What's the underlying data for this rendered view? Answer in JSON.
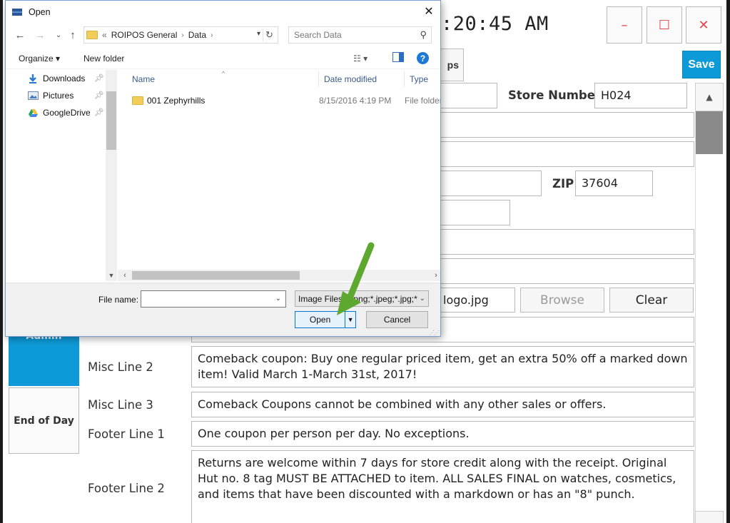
{
  "app": {
    "clock": ":20:45 AM",
    "window_buttons": {
      "minimize": "–",
      "maximize": "☐",
      "close": "✕"
    },
    "tab_partial": "ps",
    "save_label": "Save",
    "store_number_label": "Store Number",
    "store_number_value": "H024",
    "zip_label": "ZIP",
    "zip_value": "37604",
    "logo_value": "logo.jpg",
    "browse_label": "Browse",
    "clear_label": "Clear",
    "sidebar": {
      "admin": "Admin",
      "end_of_day": "End of Day"
    },
    "fields": {
      "misc2_label": "Misc Line 2",
      "misc2_value": "Comeback coupon: Buy one regular priced item, get an extra 50% off a marked down item! Valid March 1-March 31st, 2017!",
      "misc3_label": "Misc Line 3",
      "misc3_value": "Comeback Coupons cannot be combined with any other sales or offers.",
      "footer1_label": "Footer Line 1",
      "footer1_value": "One coupon per person per day. No exceptions.",
      "footer2_label": "Footer Line 2",
      "footer2_value": "Returns are welcome within 7 days for store credit along with the receipt. Original Hut no. 8 tag MUST BE ATTACHED to item.  ALL SALES FINAL on watches, cosmetics, and items that have been discounted with a markdown or has an \"8\" punch."
    }
  },
  "dialog": {
    "title": "Open",
    "close_glyph": "✕",
    "breadcrumb": {
      "prefix": "«",
      "root": "ROIPOS General",
      "separator": "›",
      "current": "Data"
    },
    "search_placeholder": "Search Data",
    "toolbar": {
      "organize": "Organize ▾",
      "new_folder": "New folder",
      "help": "?"
    },
    "nav_items": [
      {
        "label": "Downloads",
        "icon": "download-arrow-icon"
      },
      {
        "label": "Pictures",
        "icon": "pictures-icon"
      },
      {
        "label": "GoogleDrive",
        "icon": "google-drive-icon"
      }
    ],
    "columns": {
      "name": "Name",
      "date": "Date modified",
      "type": "Type"
    },
    "files": [
      {
        "name": "001 Zephyrhills",
        "date": "8/15/2016 4:19 PM",
        "type": "File folder"
      }
    ],
    "file_name_label": "File name:",
    "file_name_value": "",
    "file_type": "Image Files (*.png;*.jpeg;*.jpg;*",
    "open_label": "Open",
    "cancel_label": "Cancel"
  },
  "colors": {
    "accent_blue": "#0e9ad8",
    "close_red": "#e0464b",
    "arrow_green": "#5fa82f"
  }
}
